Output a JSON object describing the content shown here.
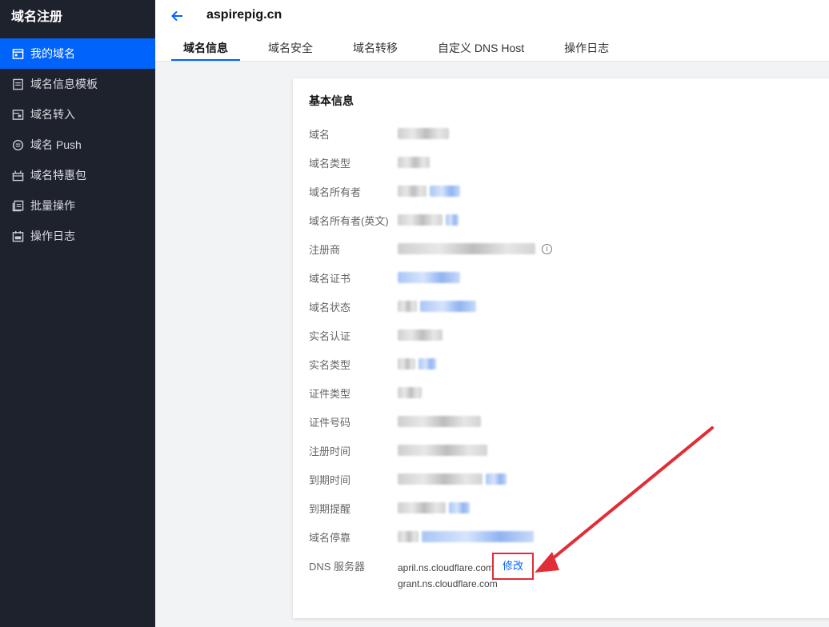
{
  "sidebar": {
    "title": "域名注册",
    "items": [
      {
        "label": "我的域名",
        "icon": "calendar-icon",
        "active": true
      },
      {
        "label": "域名信息模板",
        "icon": "document-icon"
      },
      {
        "label": "域名转入",
        "icon": "transfer-in-icon"
      },
      {
        "label": "域名 Push",
        "icon": "push-icon"
      },
      {
        "label": "域名特惠包",
        "icon": "gift-package-icon"
      },
      {
        "label": "批量操作",
        "icon": "batch-icon"
      },
      {
        "label": "操作日志",
        "icon": "log-icon"
      }
    ]
  },
  "header": {
    "back_icon": "arrow-left-icon",
    "title": "aspirepig.cn",
    "tabs": [
      {
        "label": "域名信息",
        "active": true
      },
      {
        "label": "域名安全"
      },
      {
        "label": "域名转移"
      },
      {
        "label": "自定义 DNS Host"
      },
      {
        "label": "操作日志"
      }
    ]
  },
  "basic_info": {
    "title": "基本信息",
    "rows": [
      {
        "label": "域名"
      },
      {
        "label": "域名类型"
      },
      {
        "label": "域名所有者"
      },
      {
        "label": "域名所有者(英文)"
      },
      {
        "label": "注册商"
      },
      {
        "label": "域名证书"
      },
      {
        "label": "域名状态"
      },
      {
        "label": "实名认证"
      },
      {
        "label": "实名类型"
      },
      {
        "label": "证件类型"
      },
      {
        "label": "证件号码"
      },
      {
        "label": "注册时间"
      },
      {
        "label": "到期时间"
      },
      {
        "label": "到期提醒"
      },
      {
        "label": "域名停靠"
      },
      {
        "label": "DNS 服务器"
      }
    ],
    "dns_servers": [
      "april.ns.cloudflare.com",
      "grant.ns.cloudflare.com"
    ],
    "modify_label": "修改"
  },
  "colors": {
    "sidebar_bg": "#1e222d",
    "accent": "#0063fb",
    "annotation_red": "#e02d36"
  }
}
